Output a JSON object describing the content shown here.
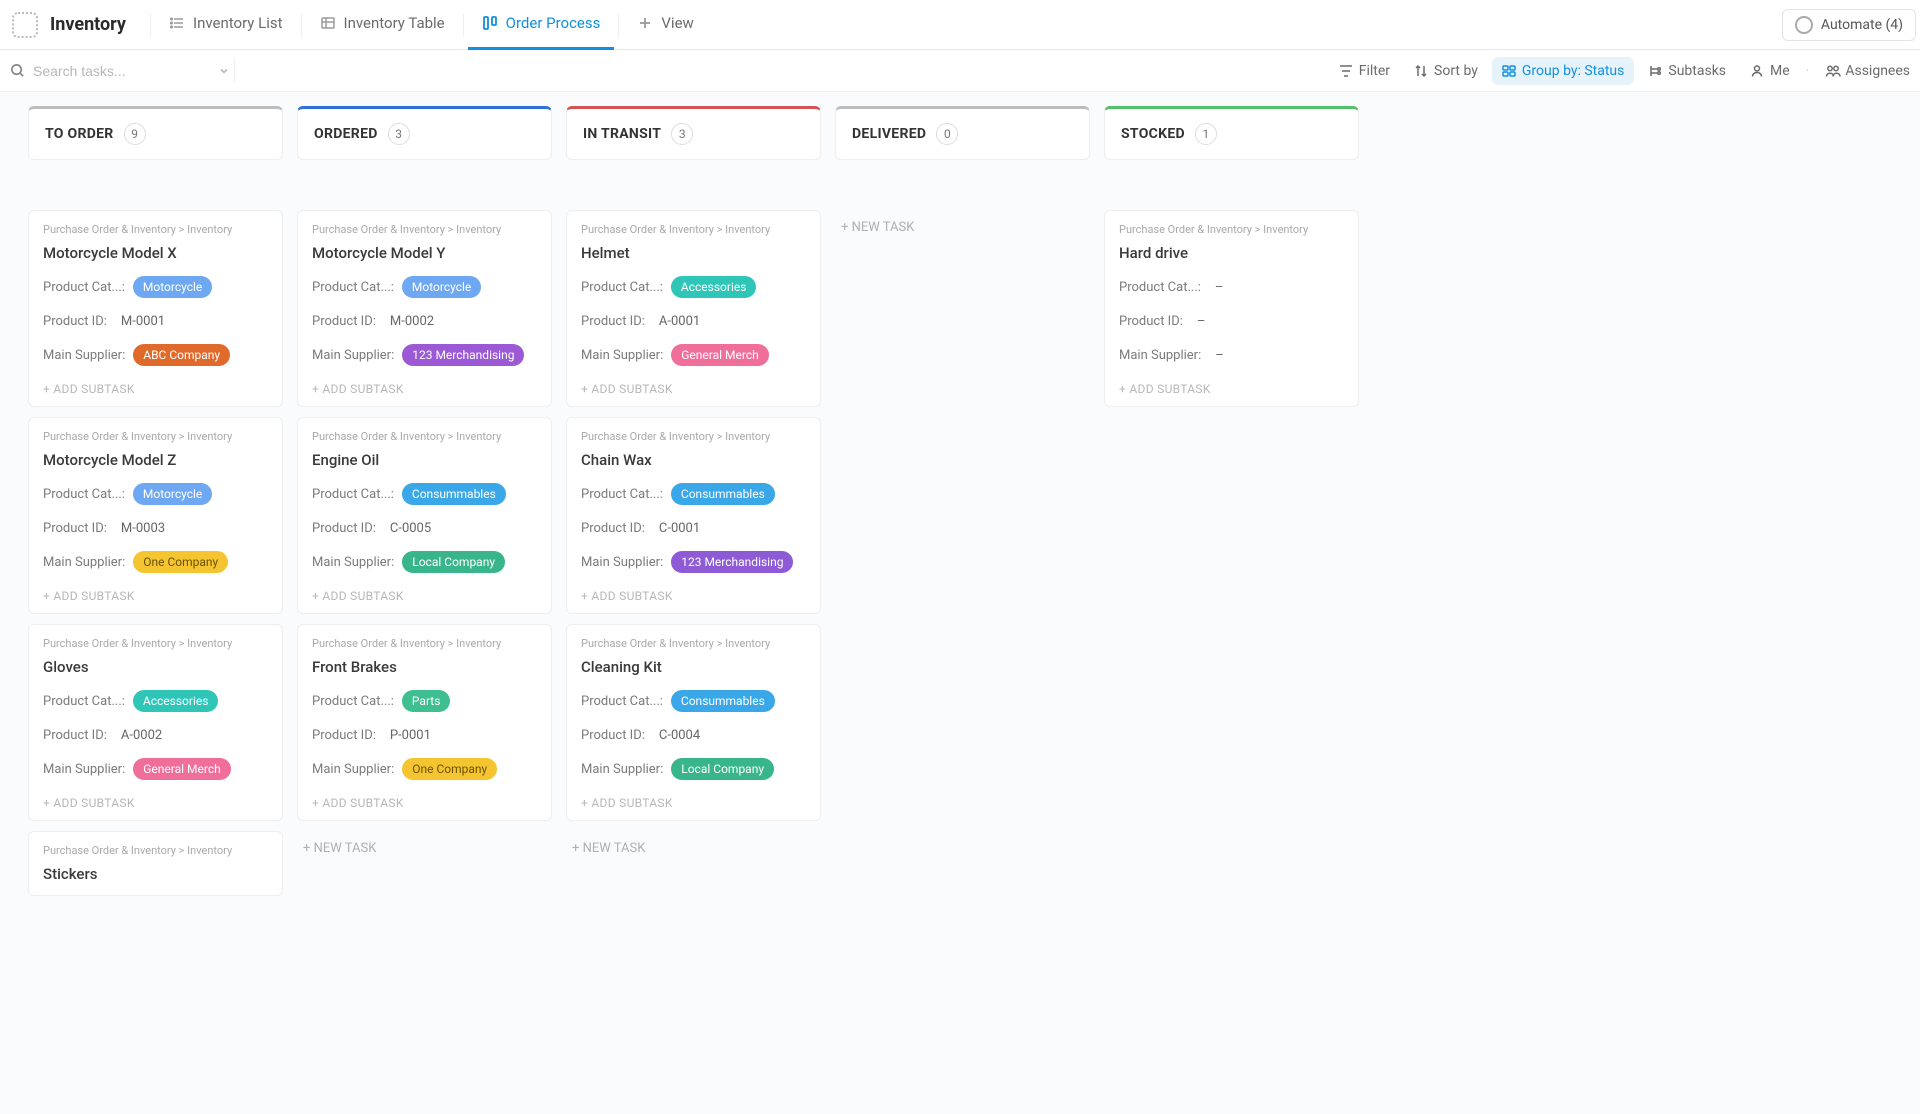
{
  "app": {
    "title": "Inventory"
  },
  "tabs": [
    {
      "label": "Inventory List",
      "icon": "list-icon",
      "active": false
    },
    {
      "label": "Inventory Table",
      "icon": "table-icon",
      "active": false
    },
    {
      "label": "Order Process",
      "icon": "board-icon",
      "active": true
    },
    {
      "label": "View",
      "icon": "plus-icon",
      "active": false
    }
  ],
  "automate": {
    "label": "Automate (4)"
  },
  "search": {
    "placeholder": "Search tasks..."
  },
  "toolbar": {
    "filter": "Filter",
    "sortby": "Sort by",
    "groupby": "Group by: Status",
    "subtasks": "Subtasks",
    "me": "Me",
    "assignees": "Assignees"
  },
  "labels": {
    "product_category": "Product Cat...",
    "product_category_full": "Product Cat...:",
    "product_id": "Product ID:",
    "main_supplier": "Main Supplier:",
    "add_subtask": "+ ADD SUBTASK",
    "new_task": "+ NEW TASK",
    "breadcrumb": "Purchase Order & Inventory  >  Inventory",
    "empty": "–"
  },
  "pill_colors": {
    "Motorcycle": "pill-motorcycle",
    "Accessories": "pill-accessories",
    "Consummables": "pill-consummables",
    "Parts": "pill-parts",
    "ABC Company": "pill-abc-company",
    "123 Merchandising": "pill-123-merchandising-p",
    "General Merch": "pill-general-merch",
    "One Company": "pill-one-company",
    "Local Company": "pill-local-company"
  },
  "columns": [
    {
      "title": "TO ORDER",
      "count": 9,
      "color": "#bdbdbd",
      "cards": [
        {
          "title": "Motorcycle Model X",
          "category": "Motorcycle",
          "product_id": "M-0001",
          "supplier": "ABC Company",
          "supplier_class": "pill-abc-company"
        },
        {
          "title": "Motorcycle Model Z",
          "category": "Motorcycle",
          "product_id": "M-0003",
          "supplier": "One Company",
          "supplier_class": "pill-one-company"
        },
        {
          "title": "Gloves",
          "category": "Accessories",
          "product_id": "A-0002",
          "supplier": "General Merch",
          "supplier_class": "pill-general-merch"
        },
        {
          "title": "Stickers",
          "partial": true
        }
      ],
      "show_new_task": false
    },
    {
      "title": "ORDERED",
      "count": 3,
      "color": "#2f6fd6",
      "cards": [
        {
          "title": "Motorcycle Model Y",
          "category": "Motorcycle",
          "product_id": "M-0002",
          "supplier": "123 Merchandising",
          "supplier_class": "pill-123-merchandising-p"
        },
        {
          "title": "Engine Oil",
          "category": "Consummables",
          "product_id": "C-0005",
          "supplier": "Local Company",
          "supplier_class": "pill-local-company"
        },
        {
          "title": "Front Brakes",
          "category": "Parts",
          "product_id": "P-0001",
          "supplier": "One Company",
          "supplier_class": "pill-one-company"
        }
      ],
      "show_new_task": true
    },
    {
      "title": "IN TRANSIT",
      "count": 3,
      "color": "#d35454",
      "cards": [
        {
          "title": "Helmet",
          "category": "Accessories",
          "product_id": "A-0001",
          "supplier": "General Merch",
          "supplier_class": "pill-general-merch"
        },
        {
          "title": "Chain Wax",
          "category": "Consummables",
          "product_id": "C-0001",
          "supplier": "123 Merchandising",
          "supplier_class": "pill-123-merchandising-b"
        },
        {
          "title": "Cleaning Kit",
          "category": "Consummables",
          "product_id": "C-0004",
          "supplier": "Local Company",
          "supplier_class": "pill-local-company"
        }
      ],
      "show_new_task": true
    },
    {
      "title": "DELIVERED",
      "count": 0,
      "color": "#bdbdbd",
      "cards": [],
      "show_new_task": true
    },
    {
      "title": "STOCKED",
      "count": 1,
      "color": "#53c06a",
      "cards": [
        {
          "title": "Hard drive",
          "category": null,
          "product_id": null,
          "supplier": null
        }
      ],
      "show_new_task": false
    }
  ]
}
